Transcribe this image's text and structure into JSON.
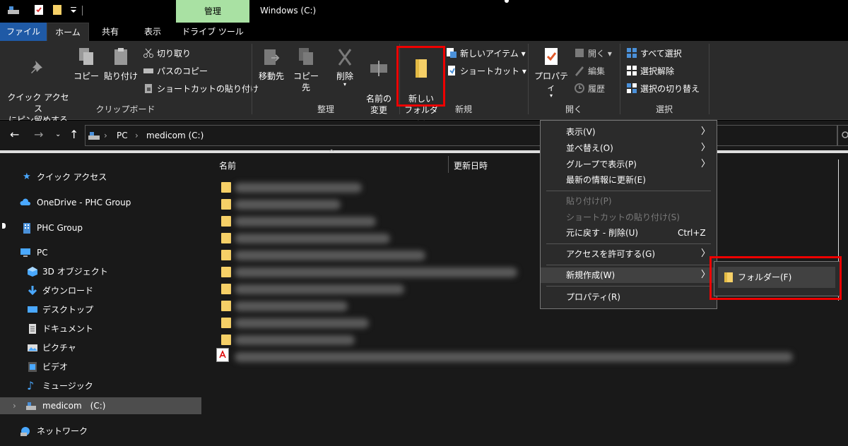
{
  "window_title": "Windows (C:)",
  "contextual_tab": "管理",
  "tabs": [
    {
      "label": "ファイル"
    },
    {
      "label": "ホーム"
    },
    {
      "label": "共有"
    },
    {
      "label": "表示"
    },
    {
      "label": "ドライブ ツール"
    }
  ],
  "ribbon": {
    "clipboard": {
      "label": "クリップボード",
      "pin": "クイック アクセス\nにピン留めする",
      "copy": "コピー",
      "paste": "貼り付け",
      "cut": "切り取り",
      "copy_path": "パスのコピー",
      "paste_shortcut": "ショートカットの貼り付け"
    },
    "organize": {
      "label": "整理",
      "move_to": "移動先",
      "copy_to": "コピー先",
      "delete": "削除",
      "rename": "名前の\n変更"
    },
    "new": {
      "label": "新規",
      "new_folder": "新しい\nフォルダー",
      "new_item": "新しいアイテム",
      "easy_access": "ショートカット"
    },
    "open": {
      "label": "開く",
      "properties": "プロパティ",
      "open": "開く",
      "edit": "編集",
      "history": "履歴"
    },
    "select": {
      "label": "選択",
      "select_all": "すべて選択",
      "select_none": "選択解除",
      "invert": "選択の切り替え"
    }
  },
  "address": {
    "crumbs": [
      "PC",
      "medicom (C:)"
    ]
  },
  "nav": {
    "quick_access": "クイック アクセス",
    "onedrive": "OneDrive - PHC Group",
    "phc": "PHC Group",
    "pc": "PC",
    "objects3d": "3D オブジェクト",
    "downloads": "ダウンロード",
    "desktop": "デスクトップ",
    "documents": "ドキュメント",
    "pictures": "ピクチャ",
    "videos": "ビデオ",
    "music": "ミュージック",
    "medicom": "medicom　(C:)",
    "network": "ネットワーク"
  },
  "columns": {
    "name": "名前",
    "modified": "更新日時"
  },
  "context_menu": {
    "view": "表示(V)",
    "sort": "並べ替え(O)",
    "group": "グループで表示(P)",
    "refresh": "最新の情報に更新(E)",
    "paste": "貼り付け(P)",
    "paste_shortcut": "ショートカットの貼り付け(S)",
    "undo": "元に戻す - 削除(U)",
    "undo_shortcut": "Ctrl+Z",
    "give_access": "アクセスを許可する(G)",
    "new": "新規作成(W)",
    "properties": "プロパティ(R)"
  },
  "submenu": {
    "folder": "フォルダー(F)"
  },
  "colors": {
    "accent_file_tab": "#1f5aa6",
    "contextual_tab": "#a9e1a3",
    "highlight_box": "#e00000",
    "folder": "#f6d067"
  }
}
